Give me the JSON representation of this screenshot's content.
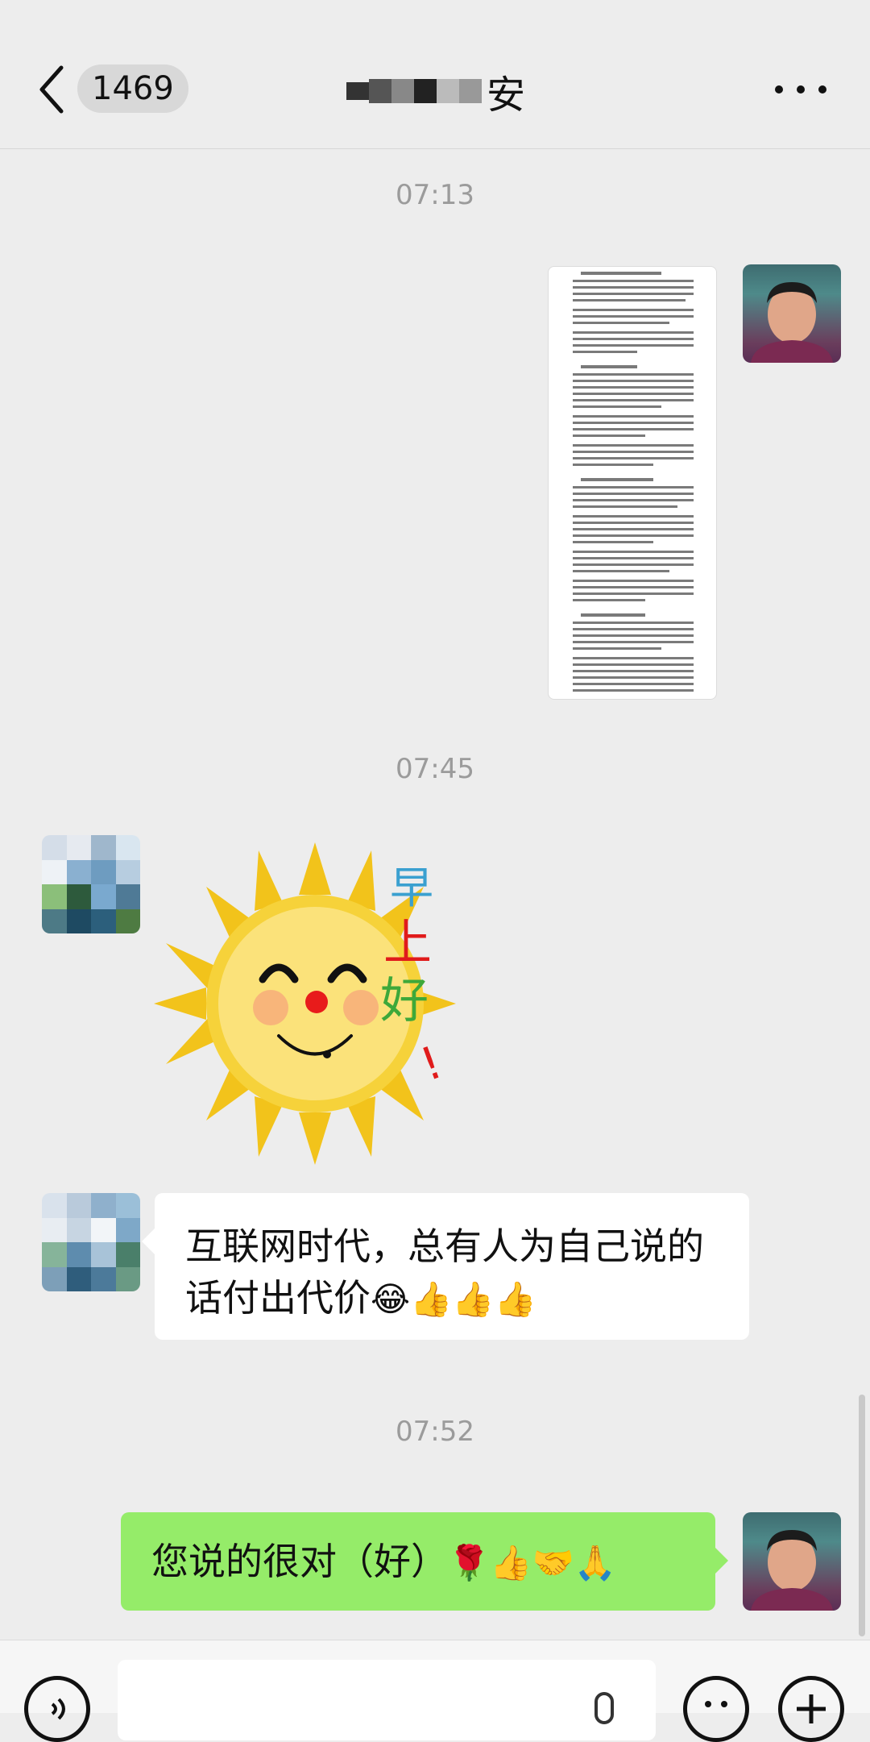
{
  "header": {
    "unread_count": "1469",
    "title_visible": "安"
  },
  "messages": [
    {
      "type": "timestamp",
      "text": "07:13"
    },
    {
      "type": "document-image",
      "from": "self"
    },
    {
      "type": "timestamp",
      "text": "07:45"
    },
    {
      "type": "sticker",
      "from": "other",
      "sticker_text": [
        "早",
        "上",
        "好",
        "!"
      ]
    },
    {
      "type": "text",
      "from": "other",
      "text": "互联网时代，总有人为自己说的话付出代价",
      "emojis": "😂👍👍👍"
    },
    {
      "type": "timestamp",
      "text": "07:52"
    },
    {
      "type": "text",
      "from": "self",
      "text": "您说的很对（好）",
      "emojis": "🌹👍🤝🙏"
    }
  ],
  "colors": {
    "background": "#ededed",
    "outgoing_bubble": "#95ec69",
    "incoming_bubble": "#ffffff"
  },
  "icons": {
    "back": "chevron-left-icon",
    "more": "more-dots-icon",
    "voice": "voice-icon",
    "mic": "mic-icon",
    "emoji": "emoji-icon",
    "plus": "plus-icon"
  }
}
